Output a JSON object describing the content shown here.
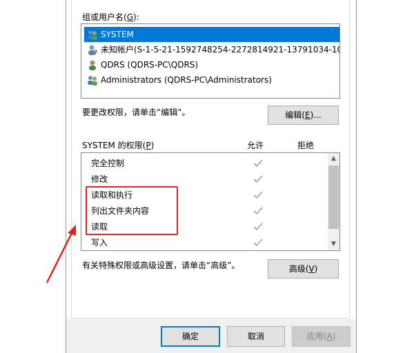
{
  "dialog": {
    "users_label": "组或用户名(",
    "users_accel": "G",
    "users_label_end": "):",
    "users": [
      {
        "name": "SYSTEM",
        "icon": "group-users-icon",
        "selected": true
      },
      {
        "name": "未知帐户(S-1-5-21-1592748254-2272814921-13791034-10...",
        "icon": "unknown-user-icon",
        "selected": false
      },
      {
        "name": "QDRS (QDRS-PC\\QDRS)",
        "icon": "user-icon",
        "selected": false
      },
      {
        "name": "Administrators (QDRS-PC\\Administrators)",
        "icon": "group-users-icon",
        "selected": false
      }
    ],
    "change_perm_text": "要更改权限，请单击“编辑”。",
    "edit_button": {
      "pre": "编辑(",
      "accel": "E",
      "post": ")..."
    },
    "perm_header": {
      "pre": "SYSTEM 的权限(",
      "accel": "P",
      "post": ")",
      "allow": "允许",
      "deny": "拒绝"
    },
    "permissions": [
      {
        "name": "完全控制",
        "allow": true,
        "deny": false
      },
      {
        "name": "修改",
        "allow": true,
        "deny": false
      },
      {
        "name": "读取和执行",
        "allow": true,
        "deny": false
      },
      {
        "name": "列出文件夹内容",
        "allow": true,
        "deny": false
      },
      {
        "name": "读取",
        "allow": true,
        "deny": false
      },
      {
        "name": "写入",
        "allow": true,
        "deny": false
      }
    ],
    "advanced_text": "有关特殊权限或高级设置，请单击“高级”。",
    "advanced_button": {
      "pre": "高级(",
      "accel": "V",
      "post": ")"
    },
    "footer": {
      "ok": "确定",
      "cancel": "取消",
      "apply_pre": "应用(",
      "apply_accel": "A",
      "apply_post": ")"
    }
  },
  "colors": {
    "selection": "#0078d7",
    "annotation": "#e02020",
    "check": "#a0a0a0"
  }
}
